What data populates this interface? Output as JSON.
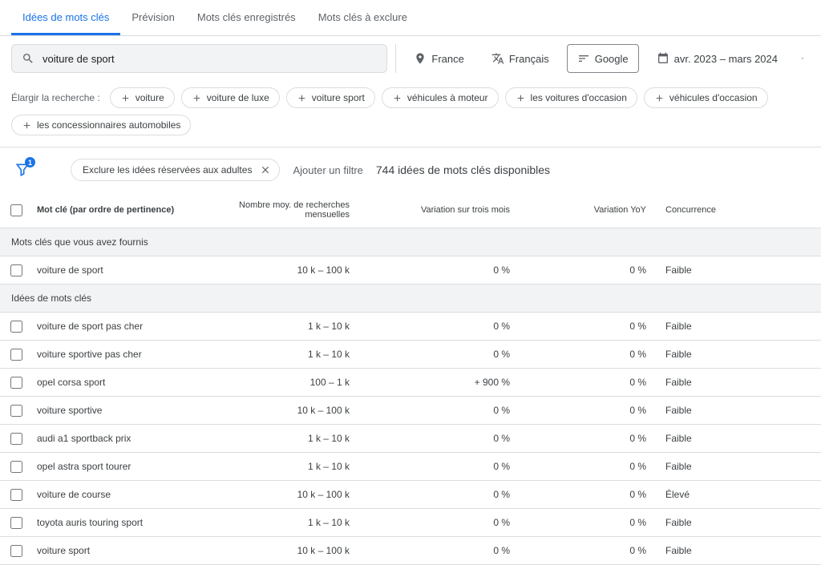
{
  "tabs": [
    {
      "label": "Idées de mots clés",
      "active": true
    },
    {
      "label": "Prévision",
      "active": false
    },
    {
      "label": "Mots clés enregistrés",
      "active": false
    },
    {
      "label": "Mots clés à exclure",
      "active": false
    }
  ],
  "search": {
    "value": "voiture de sport"
  },
  "location": {
    "label": "France"
  },
  "language": {
    "label": "Français"
  },
  "network": {
    "label": "Google"
  },
  "daterange": {
    "label": "avr. 2023 – mars 2024"
  },
  "broaden": {
    "label": "Élargir la recherche :",
    "chips": [
      "voiture",
      "voiture de luxe",
      "voiture sport",
      "véhicules à moteur",
      "les voitures d'occasion",
      "véhicules d'occasion",
      "les concessionnaires automobiles"
    ]
  },
  "filters": {
    "badge": "1",
    "applied": "Exclure les idées réservées aux adultes",
    "add_label": "Ajouter un filtre",
    "count_label": "744 idées de mots clés disponibles"
  },
  "columns": {
    "keyword": "Mot clé (par ordre de pertinence)",
    "volume": "Nombre moy. de recherches mensuelles",
    "var3m": "Variation sur trois mois",
    "varyoy": "Variation YoY",
    "comp": "Concurrence"
  },
  "sections": {
    "provided": "Mots clés que vous avez fournis",
    "ideas": "Idées de mots clés"
  },
  "rows_provided": [
    {
      "keyword": "voiture de sport",
      "volume": "10 k – 100 k",
      "var3m": "0 %",
      "varyoy": "0 %",
      "comp": "Faible"
    }
  ],
  "rows_ideas": [
    {
      "keyword": "voiture de sport pas cher",
      "volume": "1 k – 10 k",
      "var3m": "0 %",
      "varyoy": "0 %",
      "comp": "Faible"
    },
    {
      "keyword": "voiture sportive pas cher",
      "volume": "1 k – 10 k",
      "var3m": "0 %",
      "varyoy": "0 %",
      "comp": "Faible"
    },
    {
      "keyword": "opel corsa sport",
      "volume": "100 – 1 k",
      "var3m": "+ 900 %",
      "varyoy": "0 %",
      "comp": "Faible"
    },
    {
      "keyword": "voiture sportive",
      "volume": "10 k – 100 k",
      "var3m": "0 %",
      "varyoy": "0 %",
      "comp": "Faible"
    },
    {
      "keyword": "audi a1 sportback prix",
      "volume": "1 k – 10 k",
      "var3m": "0 %",
      "varyoy": "0 %",
      "comp": "Faible"
    },
    {
      "keyword": "opel astra sport tourer",
      "volume": "1 k – 10 k",
      "var3m": "0 %",
      "varyoy": "0 %",
      "comp": "Faible"
    },
    {
      "keyword": "voiture de course",
      "volume": "10 k – 100 k",
      "var3m": "0 %",
      "varyoy": "0 %",
      "comp": "Élevé"
    },
    {
      "keyword": "toyota auris touring sport",
      "volume": "1 k – 10 k",
      "var3m": "0 %",
      "varyoy": "0 %",
      "comp": "Faible"
    },
    {
      "keyword": "voiture sport",
      "volume": "10 k – 100 k",
      "var3m": "0 %",
      "varyoy": "0 %",
      "comp": "Faible"
    }
  ]
}
